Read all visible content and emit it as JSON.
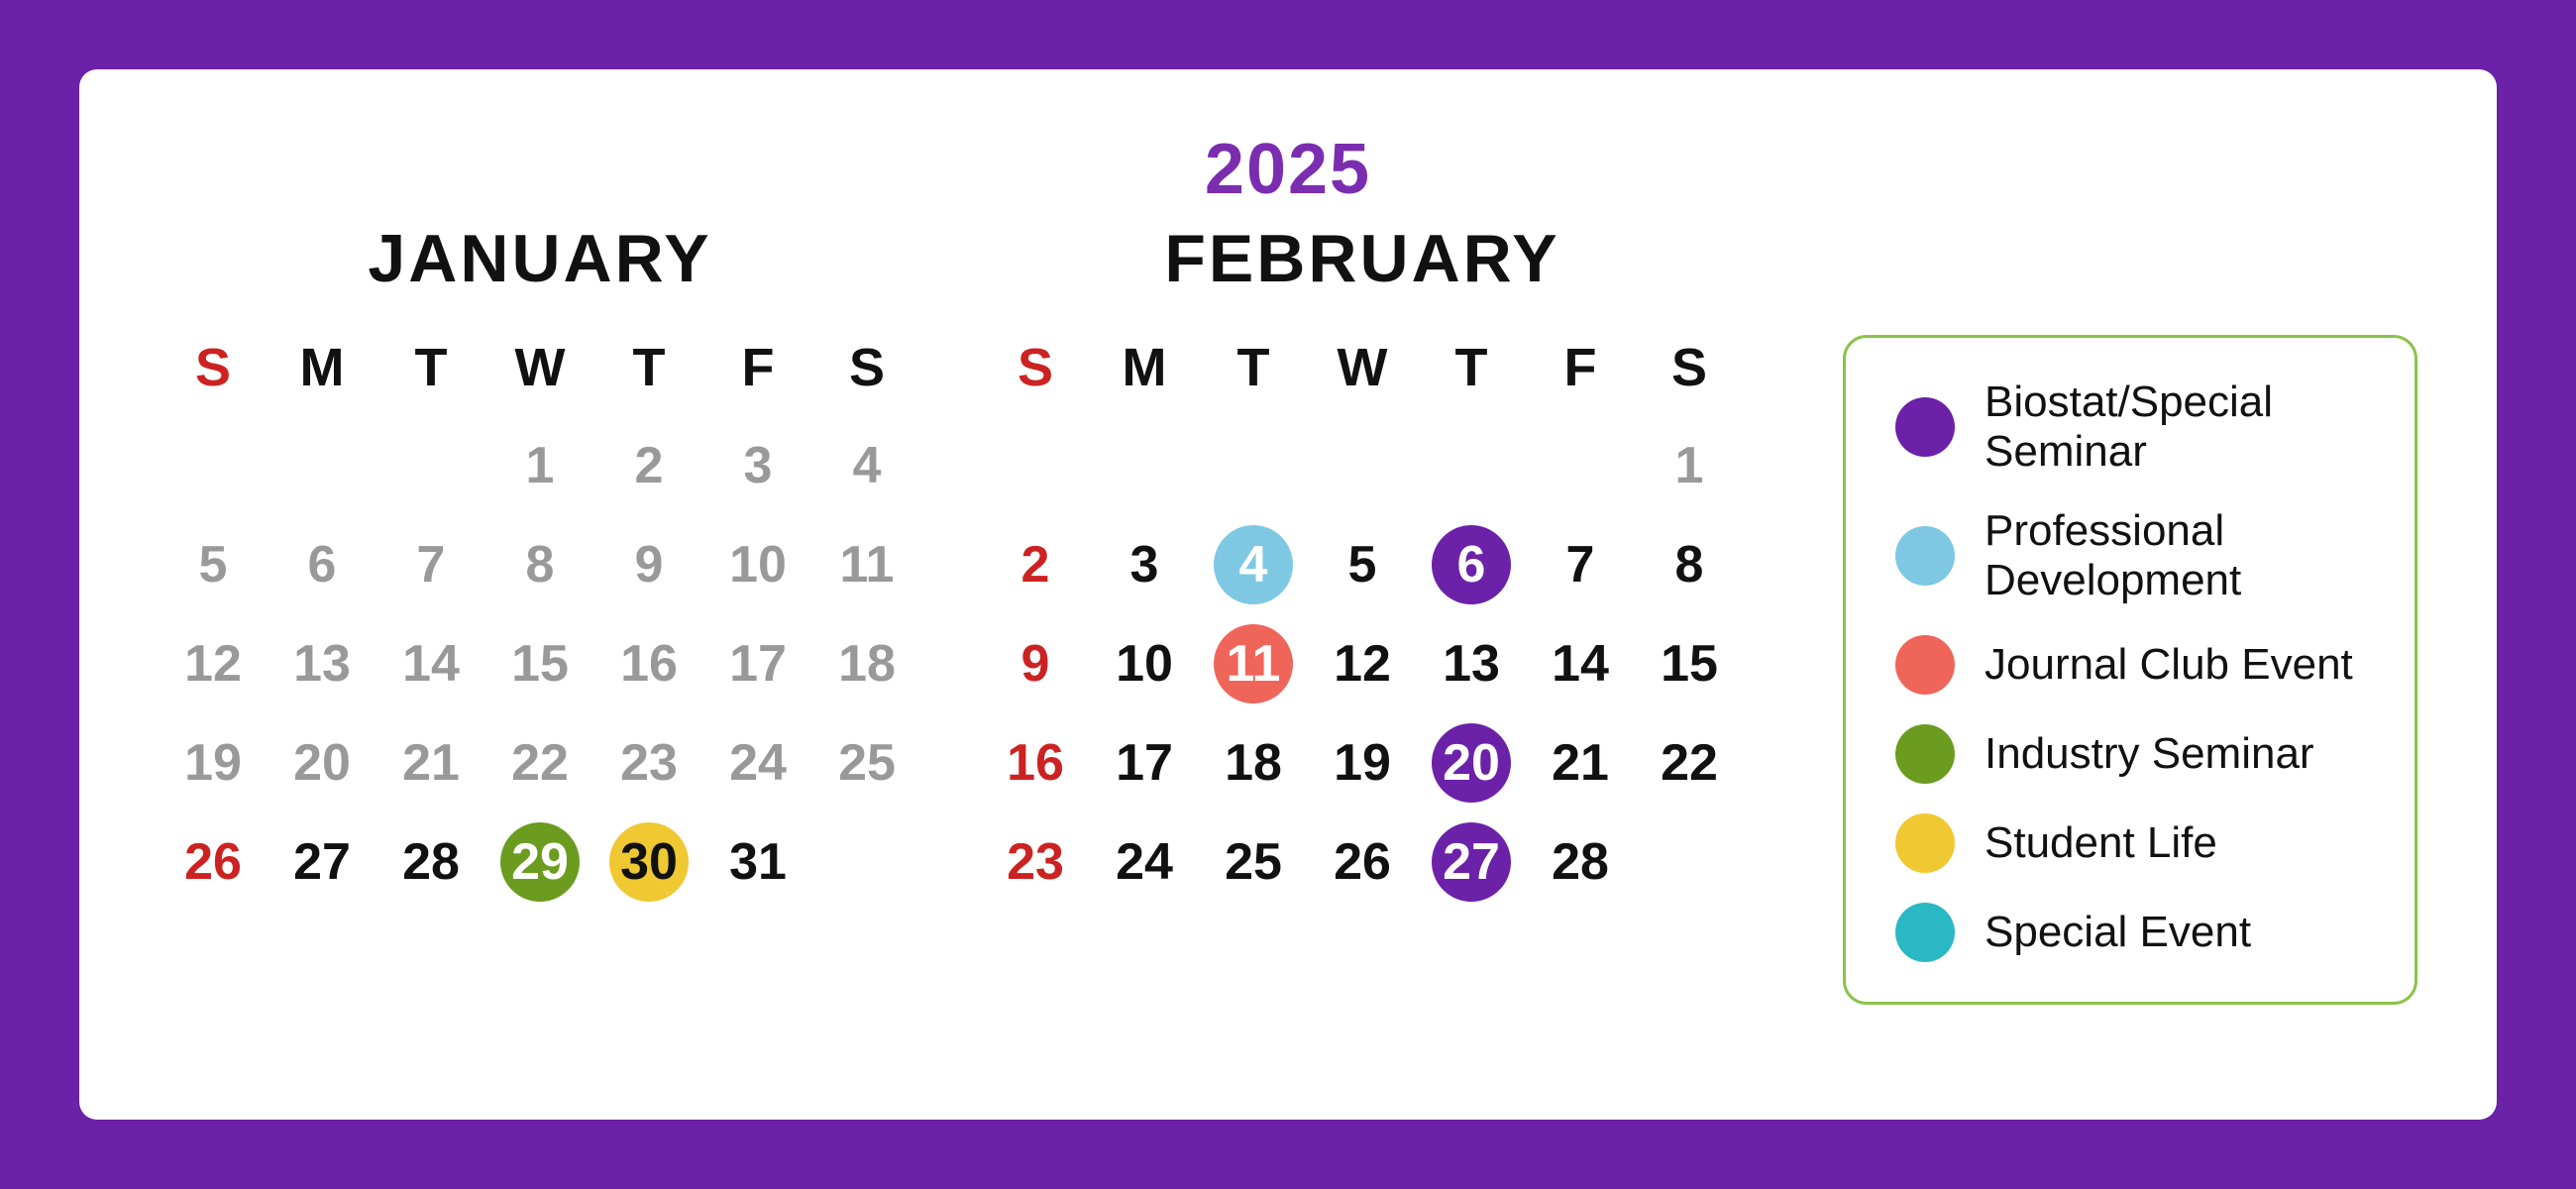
{
  "year": "2025",
  "january": {
    "title": "JANUARY",
    "headers": [
      "S",
      "M",
      "T",
      "W",
      "T",
      "F",
      "S"
    ],
    "weeks": [
      [
        null,
        null,
        null,
        "1",
        "2",
        "3",
        "4"
      ],
      [
        "5",
        "6",
        "7",
        "8",
        "9",
        "10",
        "11"
      ],
      [
        "12",
        "13",
        "14",
        "15",
        "16",
        "17",
        "18"
      ],
      [
        "19",
        "20",
        "21",
        "22",
        "23",
        "24",
        "25"
      ],
      [
        "26",
        "27",
        "28",
        "29",
        "30",
        "31",
        null
      ]
    ],
    "events": {
      "29": "green",
      "30": "yellow"
    },
    "sunday_col": 0
  },
  "february": {
    "title": "FEBRUARY",
    "headers": [
      "S",
      "M",
      "T",
      "W",
      "T",
      "F",
      "S"
    ],
    "weeks": [
      [
        null,
        null,
        null,
        null,
        null,
        null,
        "1"
      ],
      [
        "2",
        "3",
        "4",
        "5",
        "6",
        "7",
        "8"
      ],
      [
        "9",
        "10",
        "11",
        "12",
        "13",
        "14",
        "15"
      ],
      [
        "16",
        "17",
        "18",
        "19",
        "20",
        "21",
        "22"
      ],
      [
        "23",
        "24",
        "25",
        "26",
        "27",
        "28",
        null
      ]
    ],
    "events": {
      "4": "blue",
      "11": "coral",
      "6": "purple",
      "20": "purple",
      "27": "purple"
    },
    "sunday_col": 0
  },
  "legend": {
    "items": [
      {
        "color": "#6b21a8",
        "label": "Biostat/Special Seminar"
      },
      {
        "color": "#7ec8e3",
        "label": "Professional Development"
      },
      {
        "color": "#f0655a",
        "label": "Journal Club Event"
      },
      {
        "color": "#6b9c1f",
        "label": "Industry Seminar"
      },
      {
        "color": "#f0c832",
        "label": "Student Life"
      },
      {
        "color": "#2ab8c4",
        "label": "Special Event"
      }
    ]
  }
}
